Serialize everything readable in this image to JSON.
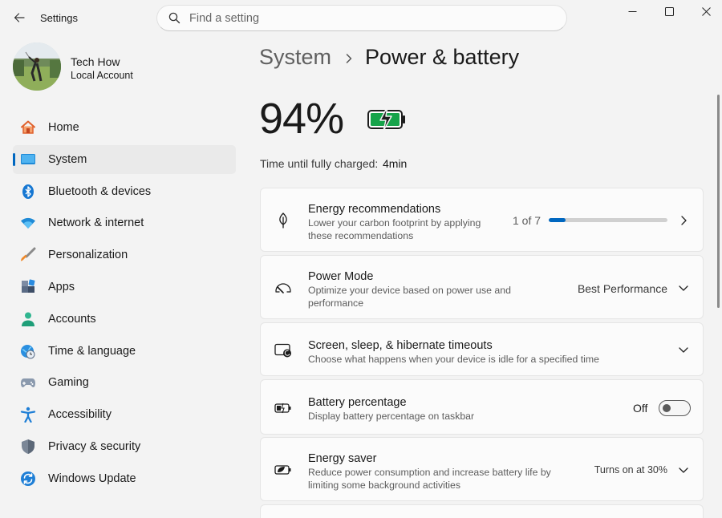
{
  "titlebar": {
    "app_title": "Settings",
    "search_placeholder": "Find a setting"
  },
  "user": {
    "name": "Tech How",
    "account_type": "Local Account"
  },
  "sidebar": {
    "items": [
      {
        "label": "Home",
        "icon": "home-icon"
      },
      {
        "label": "System",
        "icon": "monitor-icon"
      },
      {
        "label": "Bluetooth & devices",
        "icon": "bluetooth-icon"
      },
      {
        "label": "Network & internet",
        "icon": "wifi-icon"
      },
      {
        "label": "Personalization",
        "icon": "paintbrush-icon"
      },
      {
        "label": "Apps",
        "icon": "apps-icon"
      },
      {
        "label": "Accounts",
        "icon": "person-icon"
      },
      {
        "label": "Time & language",
        "icon": "globe-clock-icon"
      },
      {
        "label": "Gaming",
        "icon": "gamepad-icon"
      },
      {
        "label": "Accessibility",
        "icon": "accessibility-icon"
      },
      {
        "label": "Privacy & security",
        "icon": "shield-icon"
      },
      {
        "label": "Windows Update",
        "icon": "update-icon"
      }
    ],
    "active_index": 1
  },
  "breadcrumb": {
    "parent": "System",
    "current": "Power & battery"
  },
  "battery": {
    "percent": "94%",
    "charge_label": "Time until fully charged:",
    "charge_value": "4min",
    "charging": true
  },
  "cards": {
    "energy_recommendations": {
      "title": "Energy recommendations",
      "description": "Lower your carbon footprint by applying these recommendations",
      "progress_text": "1 of 7",
      "progress_fraction": 0.143
    },
    "power_mode": {
      "title": "Power Mode",
      "description": "Optimize your device based on power use and performance",
      "value": "Best Performance"
    },
    "screen_sleep": {
      "title": "Screen, sleep, & hibernate timeouts",
      "description": "Choose what happens when your device is idle for a specified time"
    },
    "battery_percentage": {
      "title": "Battery percentage",
      "description": "Display battery percentage on taskbar",
      "toggle_state": "Off"
    },
    "energy_saver": {
      "title": "Energy saver",
      "description": "Reduce power consumption and increase battery life by limiting some background activities",
      "value": "Turns on at 30%"
    }
  },
  "colors": {
    "accent": "#0067c0",
    "battery_green": "#16a34a"
  }
}
